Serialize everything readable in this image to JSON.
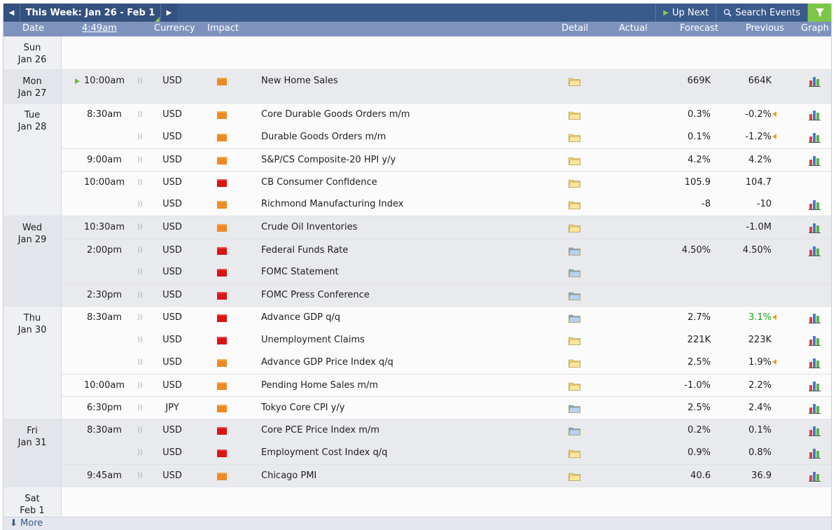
{
  "toolbar": {
    "prev_icon": "triangle-left-icon",
    "week_title": "This Week: Jan 26 - Feb 1",
    "next_icon": "triangle-right-icon",
    "up_next_label": "Up Next",
    "search_label": "Search Events",
    "filter_icon": "funnel-icon"
  },
  "header": {
    "date": "Date",
    "time": "4:49am",
    "currency": "Currency",
    "impact": "Impact",
    "detail": "Detail",
    "actual": "Actual",
    "forecast": "Forecast",
    "previous": "Previous",
    "graph": "Graph"
  },
  "colors": {
    "header_bar": "#3b5a8c",
    "subheader": "#7d93bd",
    "high_impact": "#d91515",
    "medium_impact": "#ee8a26",
    "revised_marker": "#e8a12b",
    "better_value": "#1aa318"
  },
  "days": [
    {
      "dow": "Sun",
      "date": "Jan 26",
      "shaded": false,
      "events": []
    },
    {
      "dow": "Mon",
      "date": "Jan 27",
      "shaded": true,
      "events": [
        {
          "time": "10:00am",
          "now": true,
          "sep": false,
          "currency": "USD",
          "impact": "orange",
          "name": "New Home Sales",
          "detail": "yellow",
          "forecast": "669K",
          "previous": "664K",
          "prev_revised": false,
          "prev_green": false,
          "graph": true
        }
      ]
    },
    {
      "dow": "Tue",
      "date": "Jan 28",
      "shaded": false,
      "events": [
        {
          "time": "8:30am",
          "sep": false,
          "currency": "USD",
          "impact": "orange",
          "name": "Core Durable Goods Orders m/m",
          "detail": "yellow",
          "forecast": "0.3%",
          "previous": "-0.2%",
          "prev_revised": true,
          "graph": true
        },
        {
          "time": "",
          "sep": false,
          "currency": "USD",
          "impact": "orange",
          "name": "Durable Goods Orders m/m",
          "detail": "yellow",
          "forecast": "0.1%",
          "previous": "-1.2%",
          "prev_revised": true,
          "graph": true
        },
        {
          "time": "9:00am",
          "sep": true,
          "currency": "USD",
          "impact": "orange",
          "name": "S&P/CS Composite-20 HPI y/y",
          "detail": "yellow",
          "forecast": "4.2%",
          "previous": "4.2%",
          "prev_revised": false,
          "graph": true
        },
        {
          "time": "10:00am",
          "sep": true,
          "currency": "USD",
          "impact": "red",
          "name": "CB Consumer Confidence",
          "detail": "yellow",
          "forecast": "105.9",
          "previous": "104.7",
          "prev_revised": false,
          "graph": false
        },
        {
          "time": "",
          "sep": false,
          "currency": "USD",
          "impact": "orange",
          "name": "Richmond Manufacturing Index",
          "detail": "yellow",
          "forecast": "-8",
          "previous": "-10",
          "prev_revised": false,
          "graph": true
        }
      ]
    },
    {
      "dow": "Wed",
      "date": "Jan 29",
      "shaded": true,
      "events": [
        {
          "time": "10:30am",
          "sep": false,
          "currency": "USD",
          "impact": "orange",
          "name": "Crude Oil Inventories",
          "detail": "yellow",
          "forecast": "",
          "previous": "-1.0M",
          "prev_revised": false,
          "graph": true
        },
        {
          "time": "2:00pm",
          "sep": true,
          "currency": "USD",
          "impact": "red",
          "name": "Federal Funds Rate",
          "detail": "blue",
          "forecast": "4.50%",
          "previous": "4.50%",
          "prev_revised": false,
          "graph": true
        },
        {
          "time": "",
          "sep": false,
          "currency": "USD",
          "impact": "red",
          "name": "FOMC Statement",
          "detail": "blue",
          "forecast": "",
          "previous": "",
          "prev_revised": false,
          "graph": false
        },
        {
          "time": "2:30pm",
          "sep": true,
          "currency": "USD",
          "impact": "red",
          "name": "FOMC Press Conference",
          "detail": "blue",
          "forecast": "",
          "previous": "",
          "prev_revised": false,
          "graph": false
        }
      ]
    },
    {
      "dow": "Thu",
      "date": "Jan 30",
      "shaded": false,
      "events": [
        {
          "time": "8:30am",
          "sep": false,
          "currency": "USD",
          "impact": "red",
          "name": "Advance GDP q/q",
          "detail": "blue",
          "forecast": "2.7%",
          "previous": "3.1%",
          "prev_revised": true,
          "prev_green": true,
          "graph": true
        },
        {
          "time": "",
          "sep": false,
          "currency": "USD",
          "impact": "red",
          "name": "Unemployment Claims",
          "detail": "yellow",
          "forecast": "221K",
          "previous": "223K",
          "prev_revised": false,
          "graph": true
        },
        {
          "time": "",
          "sep": false,
          "currency": "USD",
          "impact": "orange",
          "name": "Advance GDP Price Index q/q",
          "detail": "yellow",
          "forecast": "2.5%",
          "previous": "1.9%",
          "prev_revised": true,
          "graph": true
        },
        {
          "time": "10:00am",
          "sep": true,
          "currency": "USD",
          "impact": "orange",
          "name": "Pending Home Sales m/m",
          "detail": "yellow",
          "forecast": "-1.0%",
          "previous": "2.2%",
          "prev_revised": false,
          "graph": true
        },
        {
          "time": "6:30pm",
          "sep": true,
          "currency": "JPY",
          "impact": "orange",
          "name": "Tokyo Core CPI y/y",
          "detail": "blue",
          "forecast": "2.5%",
          "previous": "2.4%",
          "prev_revised": false,
          "graph": true
        }
      ]
    },
    {
      "dow": "Fri",
      "date": "Jan 31",
      "shaded": true,
      "events": [
        {
          "time": "8:30am",
          "sep": false,
          "currency": "USD",
          "impact": "red",
          "name": "Core PCE Price Index m/m",
          "detail": "blue",
          "forecast": "0.2%",
          "previous": "0.1%",
          "prev_revised": false,
          "graph": true
        },
        {
          "time": "",
          "sep": false,
          "currency": "USD",
          "impact": "red",
          "name": "Employment Cost Index q/q",
          "detail": "yellow",
          "forecast": "0.9%",
          "previous": "0.8%",
          "prev_revised": false,
          "graph": true
        },
        {
          "time": "9:45am",
          "sep": true,
          "currency": "USD",
          "impact": "orange",
          "name": "Chicago PMI",
          "detail": "yellow",
          "forecast": "40.6",
          "previous": "36.9",
          "prev_revised": false,
          "graph": true
        }
      ]
    },
    {
      "dow": "Sat",
      "date": "Feb 1",
      "shaded": false,
      "events": []
    }
  ],
  "footer": {
    "more_label": "More",
    "more_icon": "download-arrow-icon"
  }
}
